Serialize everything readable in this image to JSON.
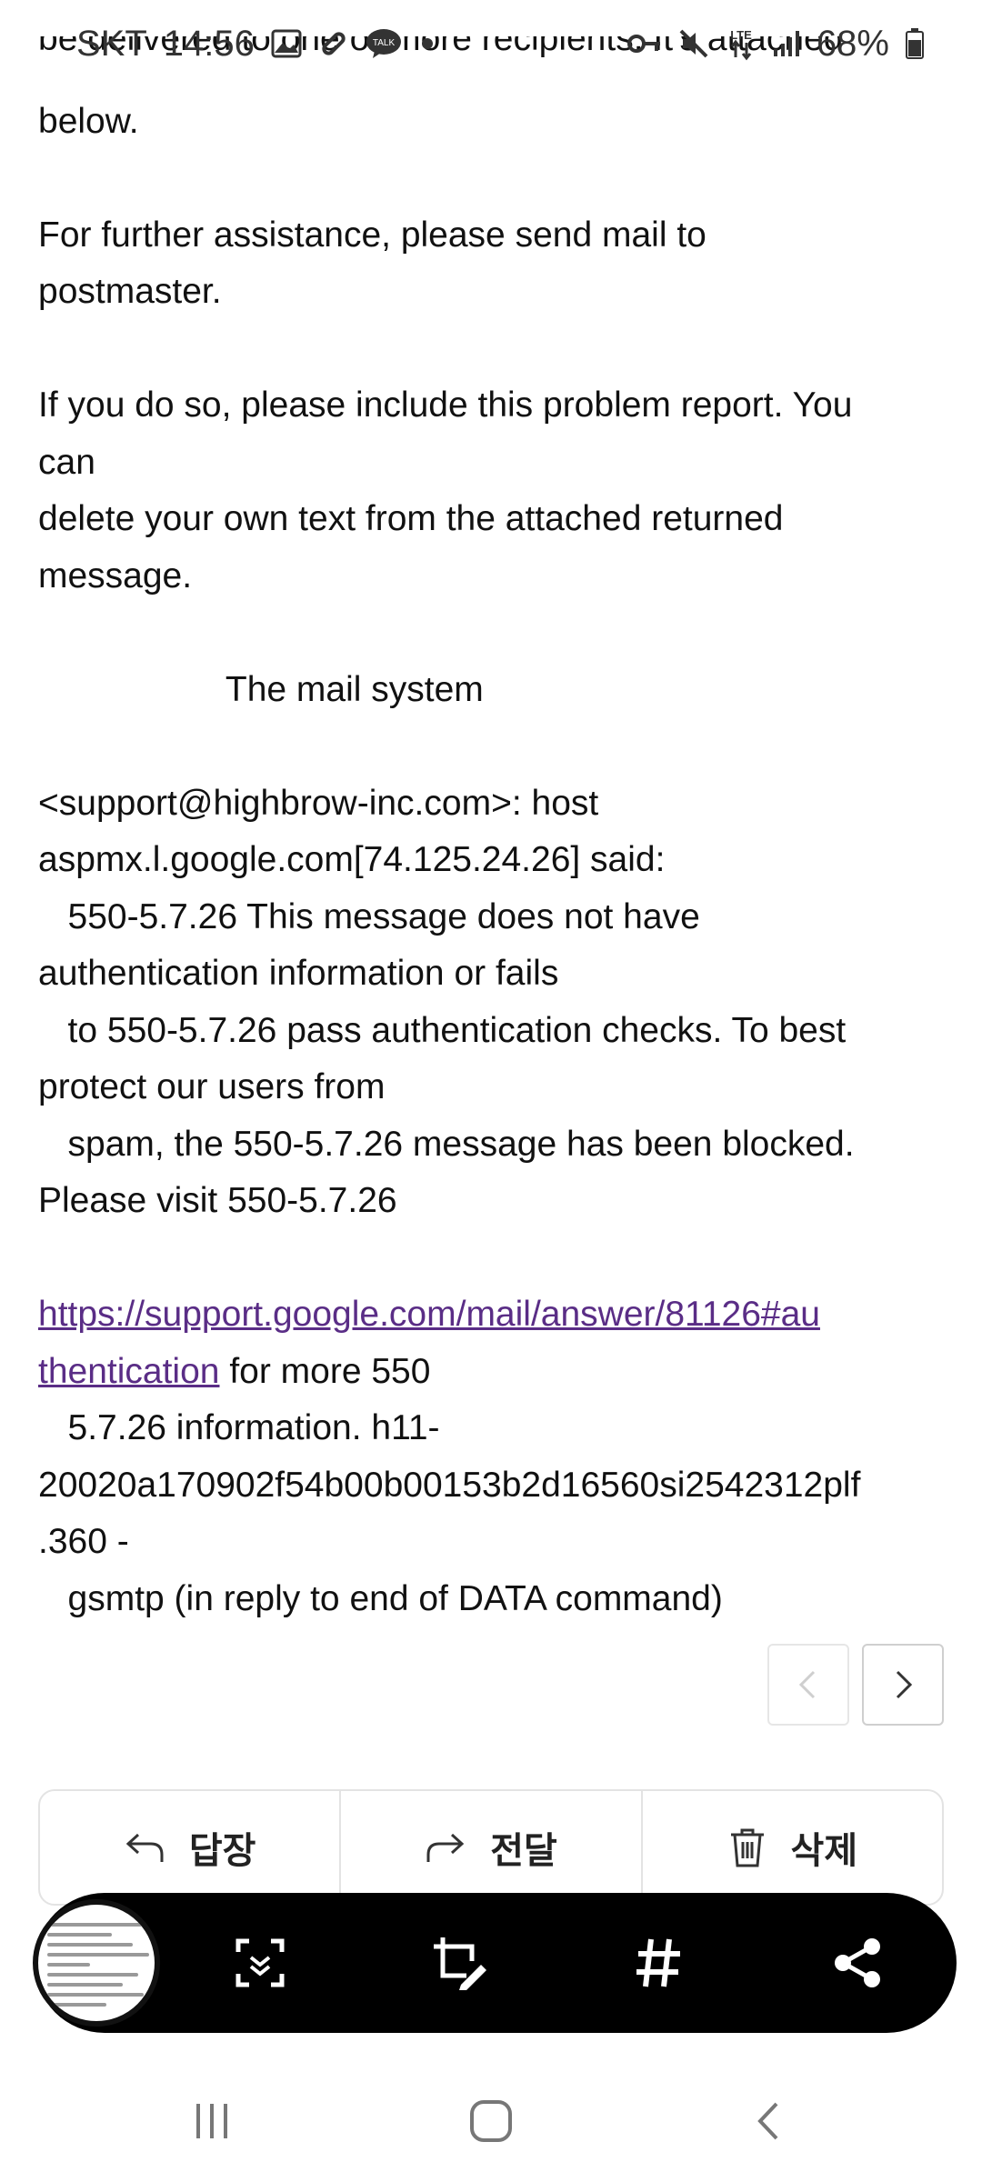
{
  "status_bar": {
    "carrier": "SKT",
    "time": "14:56",
    "battery": "68%",
    "left_icons": [
      "gallery-icon",
      "link-icon",
      "talk-icon",
      "dot-icon"
    ],
    "right_icons": [
      "vpn-key-icon",
      "mute-icon",
      "lte-icon",
      "signal-icon",
      "battery-icon"
    ],
    "talk_badge": "TALK",
    "lte_label": "LTE"
  },
  "email": {
    "clipped_line": "be delivered to one or more recipients. It's attached",
    "lines": [
      "below.",
      "",
      "For further assistance, please send mail to",
      "postmaster.",
      "",
      "If you do so, please include this problem report. You",
      "can",
      "delete your own text from the attached returned",
      "message.",
      "",
      "                   The mail system",
      "",
      "<support@highbrow-inc.com>: host",
      "aspmx.l.google.com[74.125.24.26] said:",
      "   550-5.7.26 This message does not have",
      "authentication information or fails",
      "   to 550-5.7.26 pass authentication checks. To best",
      "protect our users from",
      "   spam, the 550-5.7.26 message has been blocked.",
      "Please visit 550-5.7.26",
      ""
    ],
    "link_part1": "https://support.google.com/mail/answer/81126#au",
    "link_part2": "thentication",
    "after_link": " for more 550",
    "tail_lines": [
      "   5.7.26 information. h11-",
      "20020a170902f54b00b00153b2d16560si2542312plf",
      ".360 -",
      "   gsmtp (in reply to end of DATA command)"
    ]
  },
  "actions": {
    "reply": "답장",
    "forward": "전달",
    "delete": "삭제"
  },
  "screenshot_toolbar": {
    "tools": [
      "scroll-capture-icon",
      "crop-edit-icon",
      "hashtag-icon",
      "share-icon"
    ]
  },
  "nav_bar": {
    "buttons": [
      "recent-apps-icon",
      "home-icon",
      "back-icon"
    ]
  }
}
